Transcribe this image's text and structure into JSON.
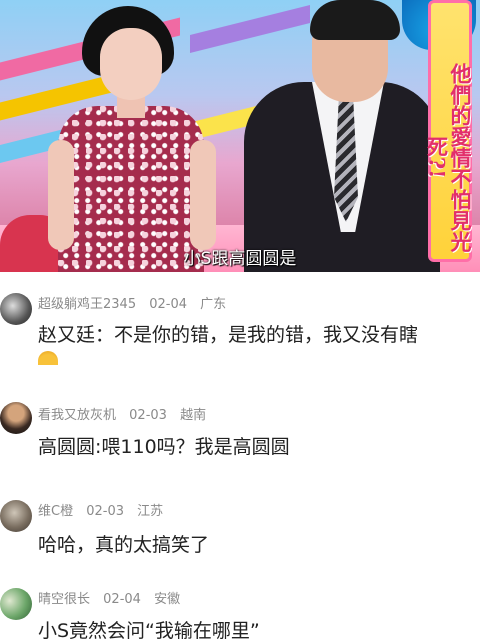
{
  "video": {
    "subtitle": "小S跟高圆圆是",
    "show_banner": "他們的愛情不怕見光死?!"
  },
  "comments": [
    {
      "user": "超级躺鸡王2345",
      "date": "02-04",
      "location": "广东",
      "text": "赵又廷：不是你的错，是我的错，我又没有瞎"
    },
    {
      "user": "看我又放灰机",
      "date": "02-03",
      "location": "越南",
      "text": "高圆圆:喂110吗？我是高圆圆"
    },
    {
      "user": "维C橙",
      "date": "02-03",
      "location": "江苏",
      "text": "哈哈，真的太搞笑了"
    },
    {
      "user": "晴空很长",
      "date": "02-04",
      "location": "安徽",
      "text": "小S竟然会问“我输在哪里”"
    }
  ]
}
